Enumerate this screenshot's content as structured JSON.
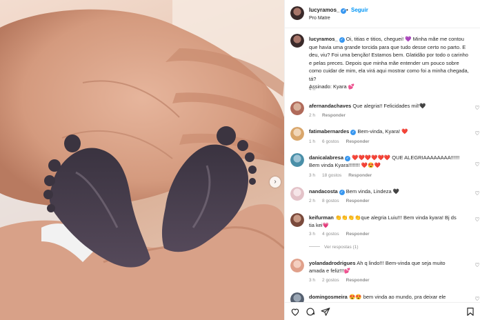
{
  "header": {
    "username": "lucyramos_",
    "follow_label": "Seguir",
    "separator": "•",
    "location": "Pro Matre",
    "more_icon": "more-icon"
  },
  "caption": {
    "username": "lucyramos_",
    "text": "Oi, titias e titios, cheguei! 💜 Minha mãe me contou que havia uma grande torcida para que tudo desse certo no parto. E deu, viu? Foi uma benção! Estamos bem. Glatidão por todo o carinho e pelas preces. Depois que minha mãe entender um pouco sobre como cuidar de mim, ela virá aqui mostrar como foi a minha chegada, tá?",
    "signature": "Assinado: Kyara 💕",
    "time": "4 h"
  },
  "comments": [
    {
      "username": "afernandachaves",
      "verified": false,
      "text": "Que alegria!! Felicidades mil!🖤",
      "time": "2 h",
      "likes": "",
      "reply": "Responder",
      "avatar_color": "#b06a5a"
    },
    {
      "username": "fatimabernardes",
      "verified": true,
      "text": "Bem-vinda, Kyara! ❤️",
      "time": "1 h",
      "likes": "6 gostos",
      "reply": "Responder",
      "avatar_color": "#d9a66b"
    },
    {
      "username": "danicalabresa",
      "verified": true,
      "text": "❤️❤️❤️❤️❤️❤️ QUE ALEGRIAAAAAAAA!!!!!! Bem vinda Kyara!!!!!!!! ❤️😍❤️",
      "time": "3 h",
      "likes": "18 gostos",
      "reply": "Responder",
      "avatar_color": "#4a8fa8"
    },
    {
      "username": "nandacosta",
      "verified": true,
      "text": "Bem vinda, Lindeza 🖤",
      "time": "2 h",
      "likes": "8 gostos",
      "reply": "Responder",
      "avatar_color": "#e3c2c8"
    },
    {
      "username": "keifurman",
      "verified": false,
      "text": "👏👏👏👏que alegria Luiu!!! Bem vinda kyara! Bj ds tia kei💗",
      "time": "3 h",
      "likes": "4 gostos",
      "reply": "Responder",
      "avatar_color": "#7a4a3c"
    },
    {
      "username": "yolandadrodrigues",
      "verified": false,
      "text": "Ah q lindo!!! Bem-vinda que seja muito amada e feliz!!!💕",
      "time": "3 h",
      "likes": "2 gostos",
      "reply": "Responder",
      "avatar_color": "#e0a08a"
    },
    {
      "username": "domingosmeira",
      "verified": false,
      "text": "😍😍 bem vinda ao mundo, pra deixar ele",
      "time": "",
      "likes": "",
      "reply": "",
      "avatar_color": "#556070"
    }
  ],
  "view_replies": "Ver respostas (1)",
  "icons": {
    "like": "heart-icon",
    "comment": "comment-icon",
    "share": "send-icon",
    "save": "bookmark-icon",
    "next": "chevron-right-icon"
  },
  "colors": {
    "link_blue": "#0095f6",
    "verified_blue": "#3897f0",
    "muted": "#8e8e8e"
  }
}
